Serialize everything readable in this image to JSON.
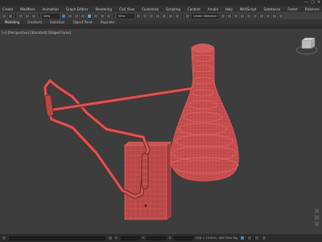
{
  "window": {
    "minimize": "—",
    "maximize": "▢",
    "close": "✕"
  },
  "menu": [
    "Create",
    "Modifiers",
    "Animation",
    "Graph Editors",
    "Rendering",
    "Civil View",
    "Customize",
    "Scripting",
    "Content",
    "Arnold",
    "Help",
    "MAXScript",
    "Substance",
    "Forest",
    "Railclone",
    "ProOptimizer",
    "Arnold Tools"
  ],
  "toolbar": {
    "view_select": "View",
    "selection_set": "Create Selection Se"
  },
  "ribbon": {
    "tabs": [
      "Modeling",
      "Freeform",
      "Selection",
      "Object Paint",
      "Populate"
    ]
  },
  "viewport": {
    "label": "[+] [Perspective] [Standard] [Edged Faces]",
    "viewcube_text": "FRONT",
    "wire_color": "#e05050",
    "face_color": "#c85252"
  },
  "status": {
    "frame_field": "0 / 100",
    "x_label": "X:",
    "y_label": "Y:",
    "z_label": "Z:",
    "grid_text": "Grid = 10.0cm",
    "addtime": "Add Time Tag",
    "auto_label": "Auto",
    "set_key": "Set Key"
  }
}
